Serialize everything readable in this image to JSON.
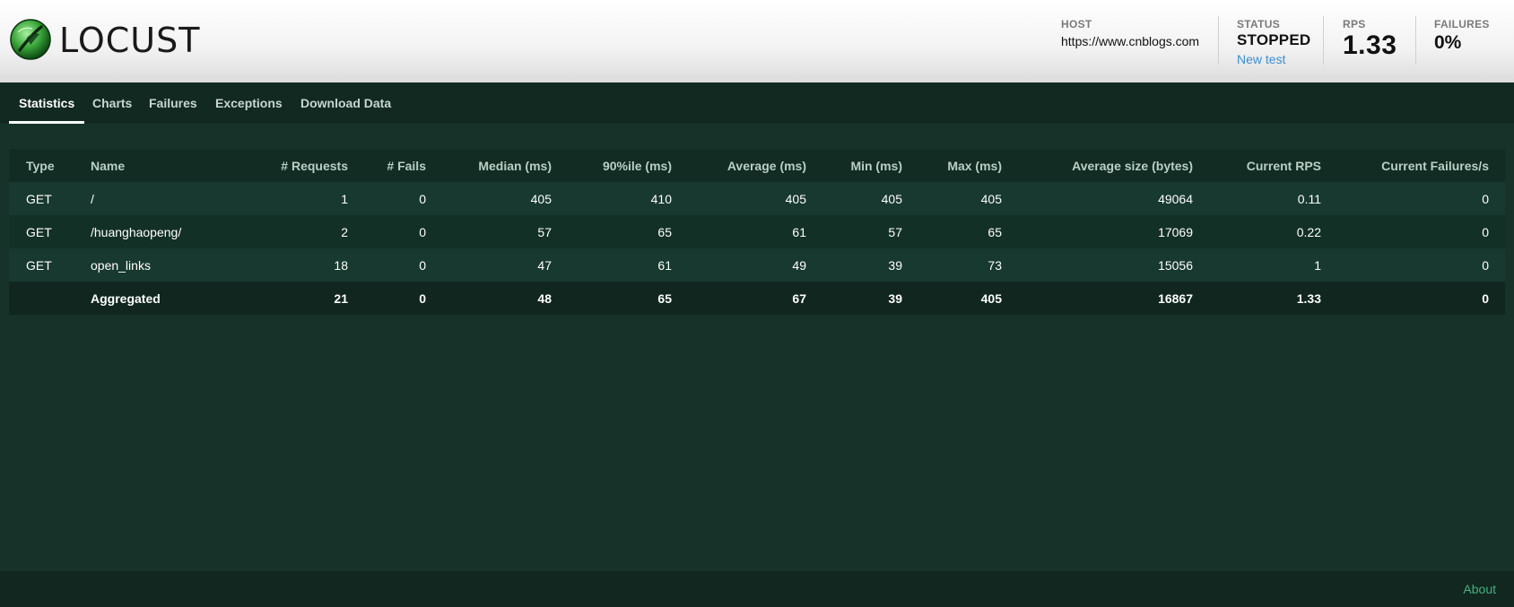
{
  "header": {
    "brand": "LOCUST",
    "host": {
      "label": "HOST",
      "value": "https://www.cnblogs.com"
    },
    "status": {
      "label": "STATUS",
      "value": "STOPPED",
      "link": "New test"
    },
    "rps": {
      "label": "RPS",
      "value": "1.33"
    },
    "failures": {
      "label": "FAILURES",
      "value": "0%"
    }
  },
  "nav": {
    "tabs": [
      {
        "label": "Statistics",
        "active": true
      },
      {
        "label": "Charts",
        "active": false
      },
      {
        "label": "Failures",
        "active": false
      },
      {
        "label": "Exceptions",
        "active": false
      },
      {
        "label": "Download Data",
        "active": false
      }
    ]
  },
  "table": {
    "columns": [
      "Type",
      "Name",
      "# Requests",
      "# Fails",
      "Median (ms)",
      "90%ile (ms)",
      "Average (ms)",
      "Min (ms)",
      "Max (ms)",
      "Average size (bytes)",
      "Current RPS",
      "Current Failures/s"
    ],
    "rows": [
      [
        "GET",
        "/",
        "1",
        "0",
        "405",
        "410",
        "405",
        "405",
        "405",
        "49064",
        "0.11",
        "0"
      ],
      [
        "GET",
        "/huanghaopeng/",
        "2",
        "0",
        "57",
        "65",
        "61",
        "57",
        "65",
        "17069",
        "0.22",
        "0"
      ],
      [
        "GET",
        "open_links",
        "18",
        "0",
        "47",
        "61",
        "49",
        "39",
        "73",
        "15056",
        "1",
        "0"
      ]
    ],
    "aggregated": [
      "",
      "Aggregated",
      "21",
      "0",
      "48",
      "65",
      "67",
      "39",
      "405",
      "16867",
      "1.33",
      "0"
    ]
  },
  "footer": {
    "about": "About"
  },
  "colors": {
    "background": "#173229",
    "nav": "#122922",
    "link": "#3a8fd0",
    "about": "#49b07e"
  }
}
